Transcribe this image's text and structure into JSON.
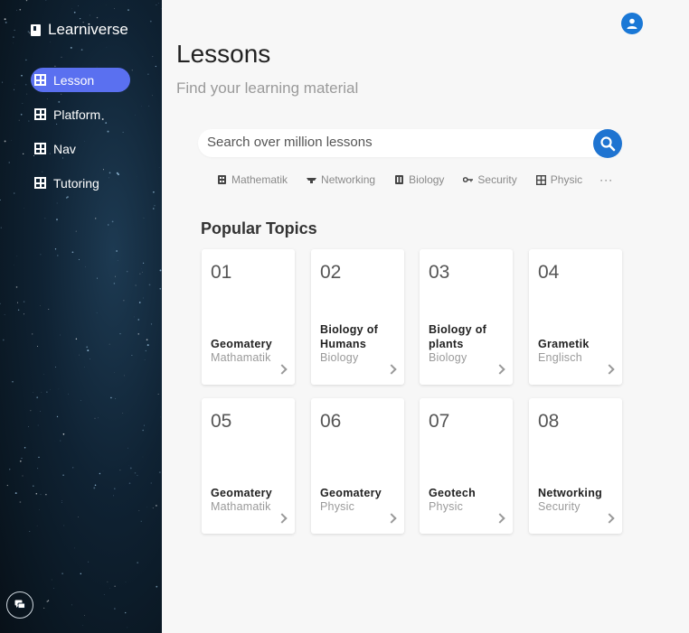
{
  "app": {
    "title": "Learniverse"
  },
  "sidebar": {
    "items": [
      {
        "label": "Lesson",
        "active": true
      },
      {
        "label": "Platform",
        "active": false
      },
      {
        "label": "Nav",
        "active": false
      },
      {
        "label": "Tutoring",
        "active": false
      }
    ]
  },
  "header": {
    "title": "Lessons",
    "subtitle": "Find your learning material"
  },
  "search": {
    "placeholder": "Search over million lessons"
  },
  "chips": [
    {
      "label": "Mathematik",
      "icon": "calculator-icon"
    },
    {
      "label": "Networking",
      "icon": "router-icon"
    },
    {
      "label": "Biology",
      "icon": "dna-icon"
    },
    {
      "label": "Security",
      "icon": "key-icon"
    },
    {
      "label": "Physic",
      "icon": "grid-icon"
    }
  ],
  "more_label": "···",
  "popular": {
    "title": "Popular Topics",
    "cards": [
      {
        "number": "01",
        "name": "Geomatery",
        "category": "Mathamatik"
      },
      {
        "number": "02",
        "name": "Biology of Humans",
        "category": "Biology"
      },
      {
        "number": "03",
        "name": "Biology of plants",
        "category": "Biology"
      },
      {
        "number": "04",
        "name": "Grametik",
        "category": "Englisch"
      },
      {
        "number": "05",
        "name": "Geomatery",
        "category": "Mathamatik"
      },
      {
        "number": "06",
        "name": "Geomatery",
        "category": "Physic"
      },
      {
        "number": "07",
        "name": "Geotech",
        "category": "Physic"
      },
      {
        "number": "08",
        "name": "Networking",
        "category": "Security"
      }
    ]
  },
  "colors": {
    "accent": "#5a70f0",
    "primary": "#1f74d1",
    "sidebar_bg": "#0f2233"
  }
}
